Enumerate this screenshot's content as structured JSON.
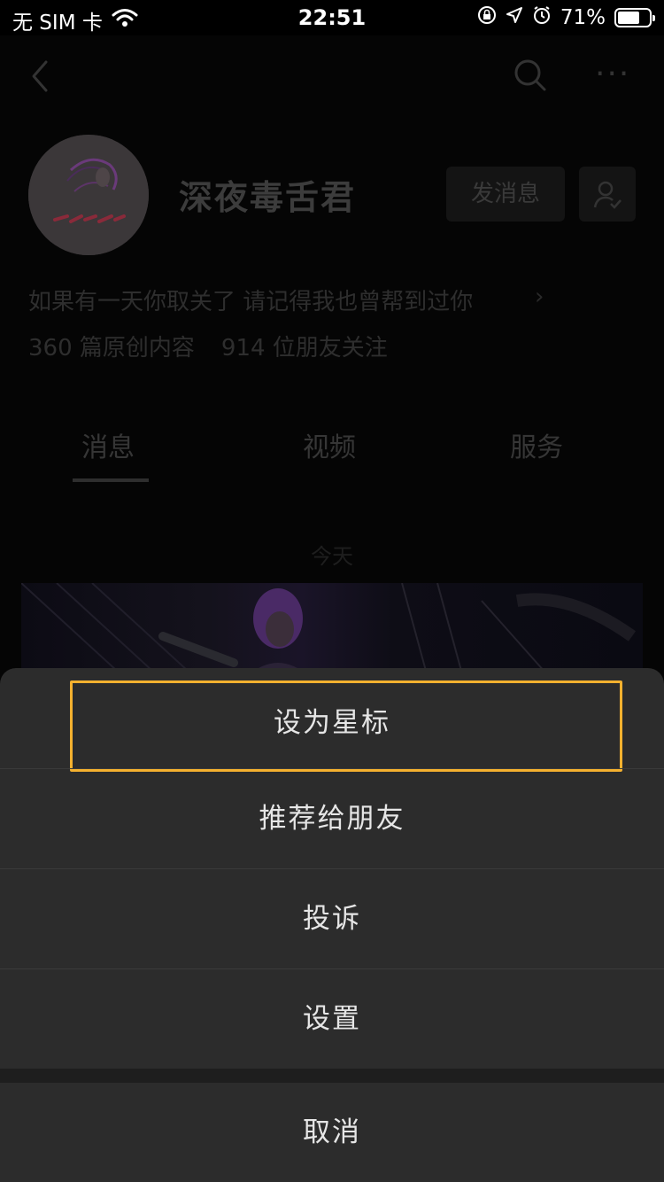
{
  "status_bar": {
    "carrier": "无 SIM 卡",
    "time": "22:51",
    "battery_percent": "71%",
    "battery_level": 0.71,
    "icons": [
      "wifi-icon",
      "orientation-lock-icon",
      "location-icon",
      "alarm-icon",
      "battery-icon"
    ]
  },
  "nav": {
    "icons": [
      "back-icon",
      "search-icon",
      "more-icon"
    ],
    "more_label": "···"
  },
  "profile": {
    "name": "深夜毒舌君",
    "send_message_label": "发消息",
    "bio": "如果有一天你取关了 请记得我也曾帮到过你",
    "bio_arrow": "›",
    "posts_count": "360 篇原创内容",
    "followers_count": "914 位朋友关注"
  },
  "tabs": [
    {
      "label": "消息"
    },
    {
      "label": "视频"
    },
    {
      "label": "服务"
    }
  ],
  "feed": {
    "date_label": "今天"
  },
  "action_sheet": {
    "items": [
      {
        "label": "设为星标"
      },
      {
        "label": "推荐给朋友"
      },
      {
        "label": "投诉"
      },
      {
        "label": "设置"
      }
    ],
    "cancel_label": "取消",
    "highlight_color": "#f4b12f"
  }
}
